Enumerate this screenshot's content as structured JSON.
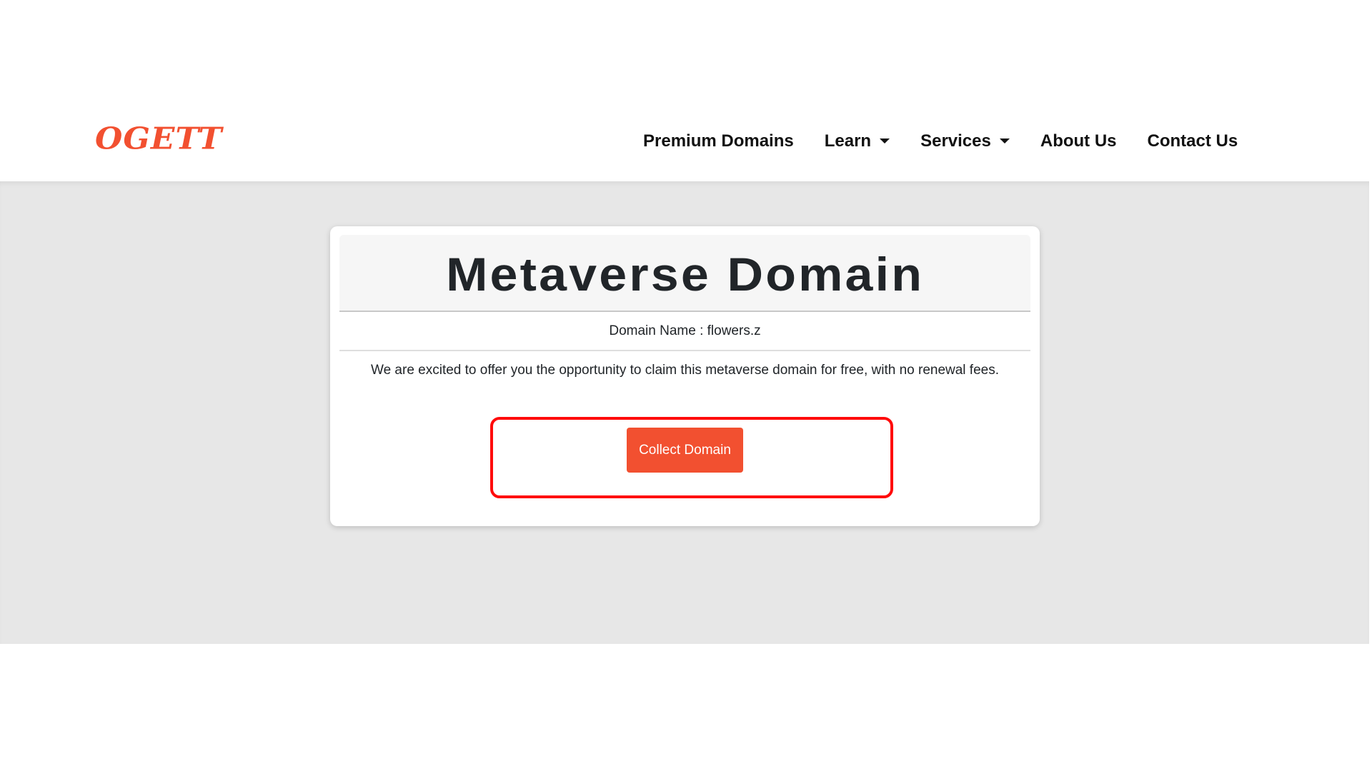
{
  "brand": {
    "logo_text": "OGETT",
    "accent_color": "#f25030"
  },
  "nav": {
    "items": [
      {
        "label": "Premium Domains",
        "has_dropdown": false
      },
      {
        "label": "Learn",
        "has_dropdown": true
      },
      {
        "label": "Services",
        "has_dropdown": true
      },
      {
        "label": "About Us",
        "has_dropdown": false
      },
      {
        "label": "Contact Us",
        "has_dropdown": false
      }
    ],
    "dropdown_icon": "caret-down-icon"
  },
  "card": {
    "title": "Metaverse Domain",
    "domain_label": "Domain Name : flowers.z",
    "description": "We are excited to offer you the opportunity to claim this metaverse domain for free, with no renewal fees.",
    "button_label": "Collect Domain",
    "highlight_color": "#ff0a0a"
  }
}
